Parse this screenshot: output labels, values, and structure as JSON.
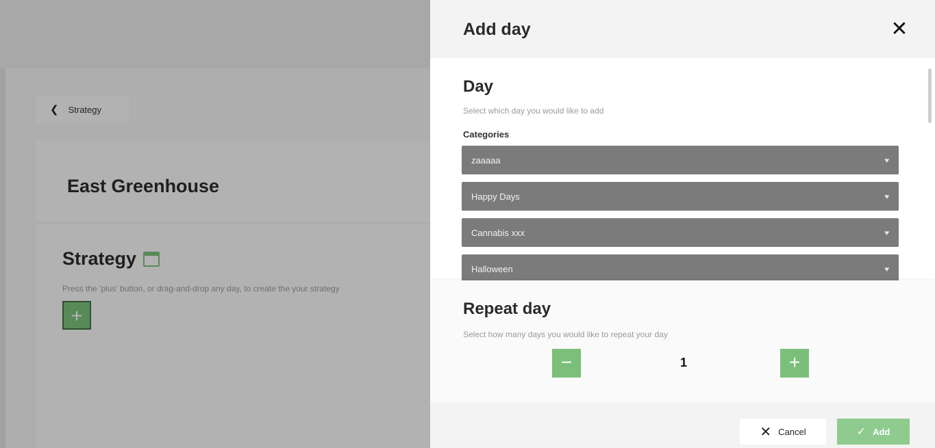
{
  "background": {
    "breadcrumb": {
      "label": "Strategy",
      "icon": "chevron-left-icon"
    },
    "greenhouse_title": "East Greenhouse",
    "strategy": {
      "title": "Strategy",
      "icon": "calendar-icon",
      "hint": "Press the 'plus' button, or drag-and-drop any day, to create the your strategy",
      "add_icon": "+"
    }
  },
  "drawer": {
    "title": "Add day",
    "close_icon": "✕",
    "day": {
      "title": "Day",
      "subtitle": "Select which day you would like to add",
      "categories_label": "Categories",
      "categories": [
        {
          "label": "zaaaaa"
        },
        {
          "label": "Happy Days"
        },
        {
          "label": "Cannabis xxx"
        },
        {
          "label": "Halloween"
        }
      ]
    },
    "repeat": {
      "title": "Repeat day",
      "subtitle": "Select how many days you would like to repeat your day",
      "value": "1",
      "minus_icon": "−",
      "plus_icon": "+"
    },
    "footer": {
      "cancel_label": "Cancel",
      "cancel_icon": "✕",
      "add_label": "Add",
      "add_icon": "✓"
    }
  },
  "colors": {
    "accent_green": "#7bbf7b",
    "category_gray": "#7b7b7b",
    "add_button": "#8fcb8f"
  }
}
